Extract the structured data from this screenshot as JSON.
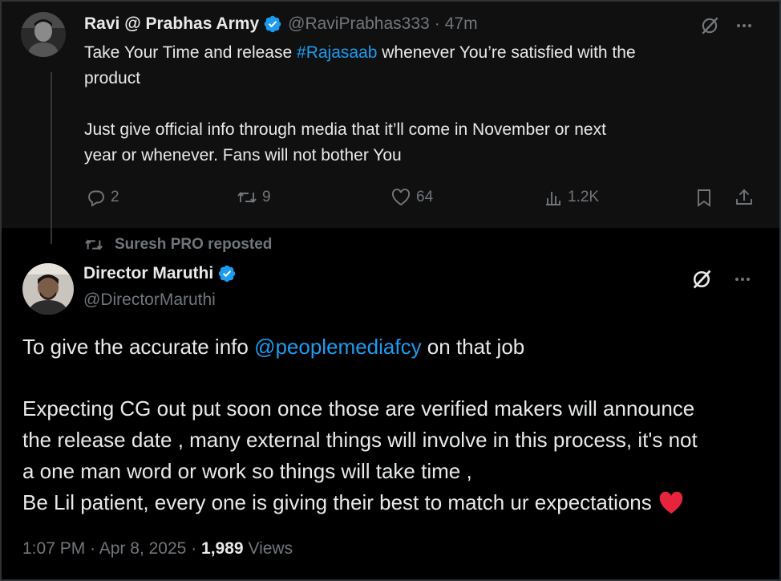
{
  "reply": {
    "name": "Ravi @ Prabhas Army",
    "handle": "@RaviPrabhas333",
    "separator": "·",
    "time": "47m",
    "line1_pre": "Take Your Time and release ",
    "hashtag": "#Rajasaab",
    "line1_post": " whenever You’re satisfied with the",
    "line2": "product",
    "line3": "Just give  official info  through media that it’ll come in November or next",
    "line4": "year or whenever.   Fans will not bother You",
    "replies": "2",
    "reposts": "9",
    "likes": "64",
    "views": "1.2K"
  },
  "repost_context": "Suresh PRO reposted",
  "main_tweet": {
    "name": "Director Maruthi",
    "handle": "@DirectorMaruthi",
    "line1_pre": "To give the accurate info ",
    "mention": "@peoplemediafcy",
    "line1_post": " on that job",
    "line2": "Expecting CG out put soon once those are verified makers will announce",
    "line3": "the release date , many external things will involve in this process, it's not",
    "line4": "a one man word or work so things will take time ,",
    "line5": "Be Lil patient, every one is giving their best to match ur expectations",
    "time": "1:07 PM",
    "sep1": "·",
    "date": "Apr 8, 2025",
    "sep2": "·",
    "views_count": "1,989",
    "views_label": "Views"
  },
  "colors": {
    "accent": "#1d9bf0",
    "muted": "#71767b",
    "text": "#e7e9ea",
    "heart": "#f91880"
  },
  "icons": [
    "verified-badge-icon",
    "grok-icon",
    "more-icon",
    "reply-icon",
    "repost-icon",
    "like-icon",
    "views-icon",
    "bookmark-icon",
    "share-icon",
    "red-heart-emoji"
  ]
}
